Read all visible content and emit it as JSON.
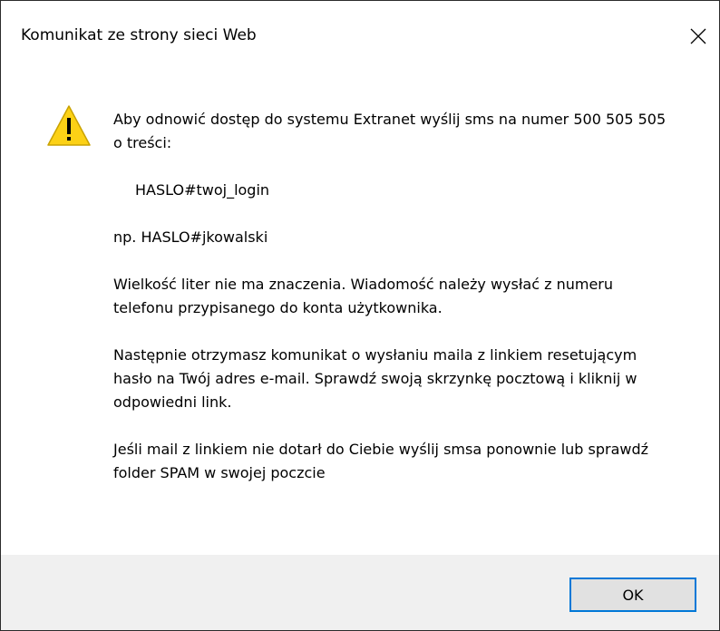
{
  "window": {
    "title": "Komunikat ze strony sieci Web"
  },
  "icons": {
    "warning": "warning-icon",
    "close": "close-icon"
  },
  "message": {
    "line1": "Aby odnowić dostęp do systemu Extranet wyślij sms na numer 500 505 505 o treści:",
    "code": "HASLO#twoj_login",
    "example": "np. HASLO#jkowalski",
    "note": "Wielkość liter nie ma znaczenia. Wiadomość należy wysłać z numeru telefonu przypisanego do konta użytkownika.",
    "next_steps": "Następnie otrzymasz komunikat o wysłaniu maila z linkiem resetującym hasło na Twój adres e-mail. Sprawdź swoją skrzynkę pocztową i kliknij w odpowiedni link.",
    "fallback": "Jeśli mail z linkiem nie dotarł do Ciebie wyślij smsa ponownie lub sprawdź folder SPAM w swojej poczcie"
  },
  "buttons": {
    "ok_label": "OK"
  },
  "colors": {
    "accent": "#0078d7",
    "warning_fill": "#fcd116",
    "footer_bg": "#f0f0f0"
  }
}
